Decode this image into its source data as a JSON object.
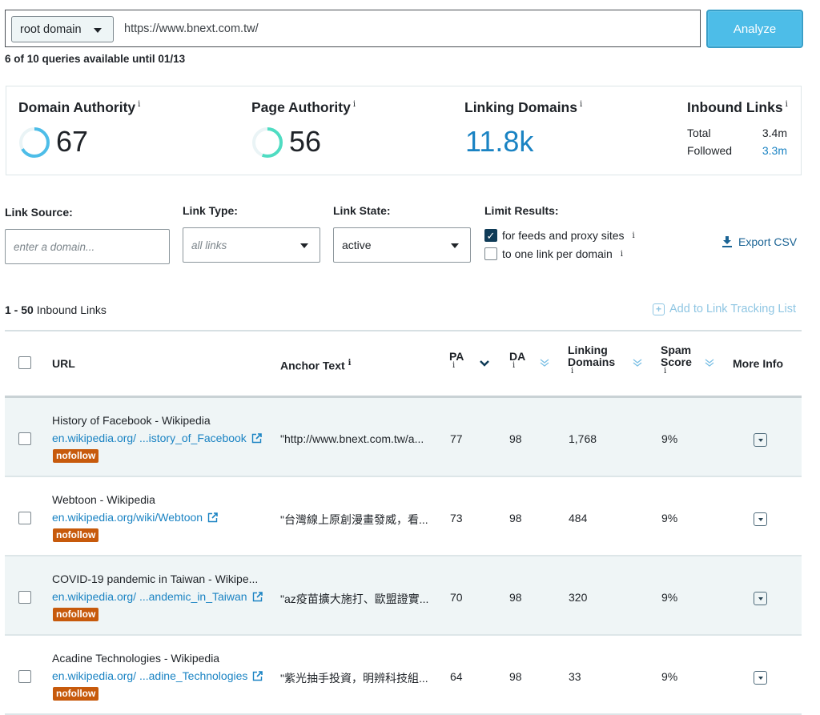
{
  "search": {
    "scope": "root domain",
    "url_value": "https://www.bnext.com.tw/",
    "analyze_label": "Analyze",
    "queries_note": "6 of 10 queries available until 01/13"
  },
  "metrics": {
    "domain_authority": {
      "label": "Domain Authority",
      "info": "i",
      "value": "67",
      "score": 67,
      "color": "#4dbde8"
    },
    "page_authority": {
      "label": "Page Authority",
      "info": "i",
      "value": "56",
      "score": 56,
      "color": "#4fdcc2"
    },
    "linking_domains": {
      "label": "Linking Domains",
      "info": "i",
      "value": "11.8k"
    },
    "inbound_links": {
      "label": "Inbound Links",
      "info": "i",
      "total_label": "Total",
      "total_value": "3.4m",
      "followed_label": "Followed",
      "followed_value": "3.3m"
    }
  },
  "filters": {
    "link_source": {
      "label": "Link Source:",
      "placeholder": "enter a domain..."
    },
    "link_type": {
      "label": "Link Type:",
      "value": "all links"
    },
    "link_state": {
      "label": "Link State:",
      "value": "active"
    },
    "limit_results": {
      "label": "Limit Results:",
      "options": [
        {
          "label": "for feeds and proxy sites",
          "checked": true,
          "info": "i"
        },
        {
          "label": "to one link per domain",
          "checked": false,
          "info": "i"
        }
      ]
    },
    "export_label": "Export CSV"
  },
  "results": {
    "range": "1 - 50",
    "range_label": "Inbound Links",
    "add_tracking_label": "Add to Link Tracking List"
  },
  "table": {
    "headers": {
      "url": "URL",
      "anchor": "Anchor Text",
      "pa": "PA",
      "da": "DA",
      "linking_domains_1": "Linking",
      "linking_domains_2": "Domains",
      "spam_1": "Spam",
      "spam_2": "Score",
      "more_info": "More Info",
      "info": "i"
    },
    "rows": [
      {
        "title": "History of Facebook - Wikipedia",
        "url": "en.wikipedia.org/ ...istory_of_Facebook",
        "badge": "nofollow",
        "anchor": "\"http://www.bnext.com.tw/a...",
        "pa": "77",
        "da": "98",
        "linking_domains": "1,768",
        "spam_score": "9%"
      },
      {
        "title": "Webtoon - Wikipedia",
        "url": "en.wikipedia.org/wiki/Webtoon",
        "badge": "nofollow",
        "anchor": "\"台灣線上原創漫畫發威，看...",
        "pa": "73",
        "da": "98",
        "linking_domains": "484",
        "spam_score": "9%"
      },
      {
        "title": "COVID-19 pandemic in Taiwan - Wikipe...",
        "url": "en.wikipedia.org/ ...andemic_in_Taiwan",
        "badge": "nofollow",
        "anchor": "\"az疫苗擴大施打、歐盟證實...",
        "pa": "70",
        "da": "98",
        "linking_domains": "320",
        "spam_score": "9%"
      },
      {
        "title": "Acadine Technologies - Wikipedia",
        "url": "en.wikipedia.org/ ...adine_Technologies",
        "badge": "nofollow",
        "anchor": "\"紫光抽手投資，明辨科技組...",
        "pa": "64",
        "da": "98",
        "linking_domains": "33",
        "spam_score": "9%"
      }
    ]
  }
}
